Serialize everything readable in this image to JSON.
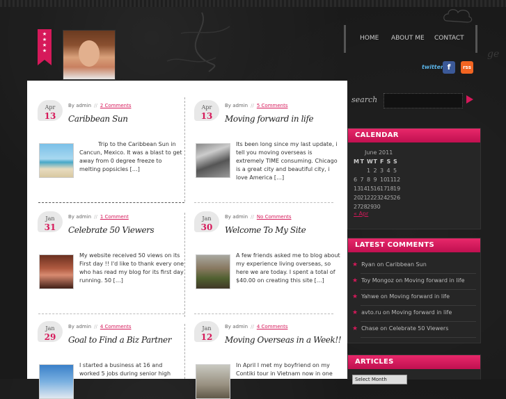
{
  "nav": [
    "HOME",
    "ABOUT ME",
    "CONTACT"
  ],
  "social": [
    {
      "icon": "twitter-icon",
      "label": "twitter",
      "color": "#1da1f2"
    },
    {
      "icon": "facebook-icon",
      "label": "f",
      "color": "#3b5998"
    },
    {
      "icon": "rss-icon",
      "label": "rss",
      "color": "#f26522"
    }
  ],
  "header_doodle_text": "ge",
  "posts": [
    {
      "mon": "Apr",
      "day": "13",
      "author": "admin",
      "comments": "2 Comments",
      "title": "Caribbean Sun",
      "excerpt": "Trip to the Caribbean Sun in Cancun, Mexico. It was a blast to get away from 0 degree freeze to melting popsicles […]"
    },
    {
      "mon": "Apr",
      "day": "13",
      "author": "admin",
      "comments": "5 Comments",
      "title": "Moving forward in life",
      "excerpt": "Its been long since my last update, i tell you moving overseas is extremely TIME consuming. Chicago is a great city and beautiful city, i love America […]"
    },
    {
      "mon": "Jan",
      "day": "31",
      "author": "admin",
      "comments": "1 Comment",
      "title": "Celebrate 50 Viewers",
      "excerpt": "My website received 50 views on its First day !! I'd like to thank every one who has read my blog for its first day running. 50 […]"
    },
    {
      "mon": "Jan",
      "day": "30",
      "author": "admin",
      "comments": "No Comments",
      "title": "Welcome To My Site",
      "excerpt": "A few friends asked me to blog about my experience living overseas, so here we are today. I spent a total of $40.00 on creating this site […]"
    },
    {
      "mon": "Jan",
      "day": "29",
      "author": "admin",
      "comments": "4 Comments",
      "title": "Goal to Find a Biz Partner",
      "excerpt": "I started a business at 16 and worked 5 jobs during senior high"
    },
    {
      "mon": "Jan",
      "day": "12",
      "author": "admin",
      "comments": "4 Comments",
      "title": "Moving Overseas in a Week!!",
      "excerpt": "In April I met my boyfriend on my Contiki tour in Vietnam now in one"
    }
  ],
  "by_label": "By",
  "sep": "//",
  "sidebar": {
    "search_label": "search",
    "calendar": {
      "title": "CALENDAR",
      "month": "June 2011",
      "weekdays": [
        "M",
        "T",
        "W",
        "T",
        "F",
        "S",
        "S"
      ],
      "rows": [
        [
          "",
          "",
          "1",
          "2",
          "3",
          "4",
          "5"
        ],
        [
          "6",
          "7",
          "8",
          "9",
          "10",
          "11",
          "12"
        ],
        [
          "13",
          "14",
          "15",
          "16",
          "17",
          "18",
          "19"
        ],
        [
          "20",
          "21",
          "22",
          "23",
          "24",
          "25",
          "26"
        ],
        [
          "27",
          "28",
          "29",
          "30",
          "",
          "",
          ""
        ]
      ],
      "prev": "« Apr"
    },
    "comments": {
      "title": "LATEST COMMENTS",
      "items": [
        "Ryan on Caribbean Sun",
        "Toy Mongoz on Moving forward in life",
        "Yahwe on Moving forward in life",
        "avto.ru on Moving forward in life",
        "Chase on Celebrate 50 Viewers"
      ]
    },
    "archives": {
      "title": "ARTICLES",
      "select": "Select Month"
    }
  },
  "colors": {
    "accent": "#d6195a",
    "background": "#1a1a1a",
    "widget": "#262626"
  }
}
